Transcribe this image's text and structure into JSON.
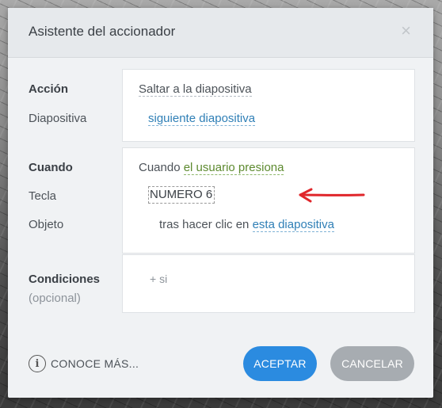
{
  "dialog": {
    "title": "Asistente del accionador",
    "close_glyph": "×"
  },
  "action": {
    "label": "Acción",
    "value": "Saltar a la diapositiva",
    "slide_label": "Diapositiva",
    "slide_value": "siguiente diapositiva"
  },
  "when": {
    "label": "Cuando",
    "prefix": "Cuando",
    "event": "el usuario presiona",
    "key_label": "Tecla",
    "key_value": "NUMERO 6",
    "object_label": "Objeto",
    "object_prefix": "tras hacer clic en",
    "object_value": "esta diapositiva"
  },
  "conditions": {
    "label": "Condiciones",
    "sublabel": "(opcional)",
    "add": "+ si"
  },
  "footer": {
    "info_icon": "info-icon",
    "learn_more": "CONOCE MÁS...",
    "accept": "ACEPTAR",
    "cancel": "CANCELAR"
  },
  "colors": {
    "accent": "#2b8be0",
    "link": "#2f7fb6",
    "event_link": "#5d8a2f",
    "annotation_arrow": "#e0262b"
  }
}
